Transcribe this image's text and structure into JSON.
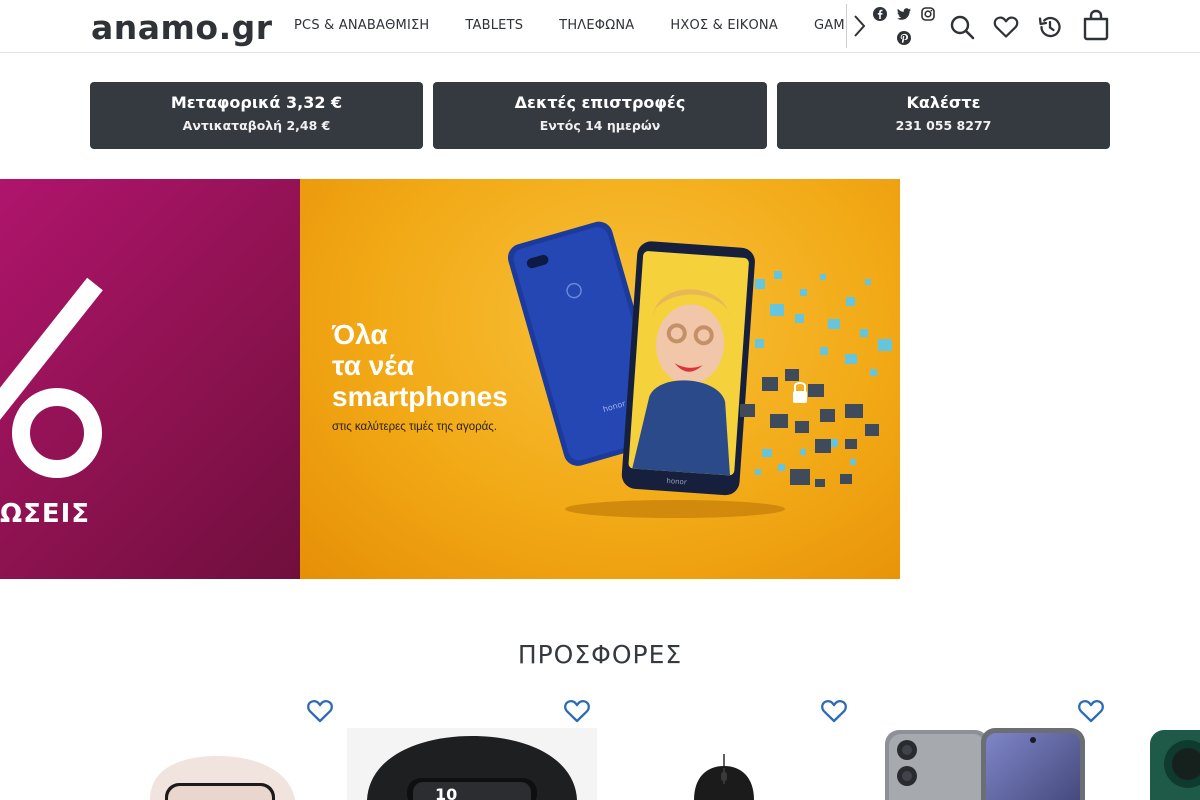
{
  "header": {
    "logo": "anamo.gr",
    "nav_items": [
      "PCS & ΑΝΑΒΑΘΜΙΣΗ",
      "TABLETS",
      "ΤΗΛΕΦΩΝΑ",
      "ΗΧΟΣ & ΕΙΚΟΝΑ",
      "GAMING"
    ],
    "nav_arrow_icon": "chevron-right-icon",
    "social_icons": [
      "facebook-icon",
      "twitter-icon",
      "instagram-icon",
      "pinterest-icon"
    ],
    "action_icons": [
      "search-icon",
      "heart-icon",
      "history-icon",
      "shopping-bag-icon"
    ]
  },
  "info_boxes": [
    {
      "title": "Μεταφορικά 3,32 €",
      "subtitle": "Αντικαταβολή 2,48 €"
    },
    {
      "title": "Δεκτές επιστροφές",
      "subtitle": "Εντός 14 ημερών"
    },
    {
      "title": "Καλέστε",
      "subtitle": "231 055 8277"
    }
  ],
  "banner": {
    "left_partial_text": "ΩΣΕΙΣ",
    "headline_lines": [
      "Όλα",
      "τα νέα",
      "smartphones"
    ],
    "caption": "στις καλύτερες τιμές της αγοράς.",
    "phone_brand": "honor"
  },
  "offers": {
    "title": "ΠΡΟΣΦΟΡΕΣ",
    "products": [
      {
        "image": "smartwatch-pink",
        "favorite_icon": "heart-outline-icon"
      },
      {
        "image": "smartwatch-black",
        "favorite_icon": "heart-outline-icon"
      },
      {
        "image": "gaming-mouse",
        "favorite_icon": "heart-outline-icon"
      },
      {
        "image": "smartphone-gray",
        "favorite_icon": "heart-outline-icon"
      },
      {
        "image": "smartphone-green",
        "favorite_icon": "heart-outline-icon"
      }
    ]
  },
  "colors": {
    "dark": "#353940",
    "accent_blue": "#2b6cb5",
    "banner_magenta": "#9b1359",
    "banner_yellow": "#f2a916"
  }
}
